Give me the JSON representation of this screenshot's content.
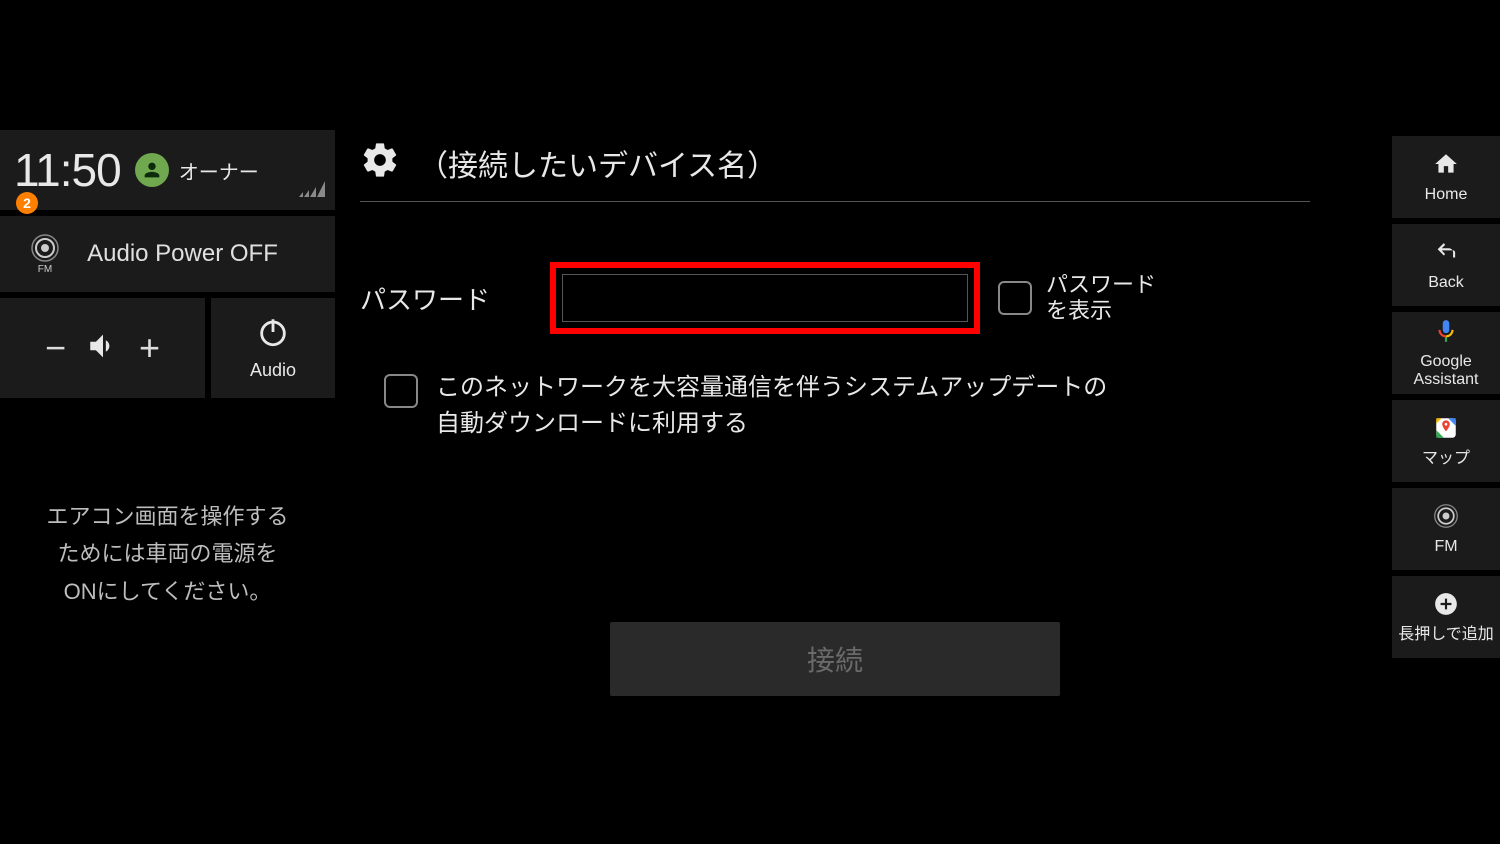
{
  "status": {
    "time": "11:50",
    "notification_count": "2",
    "user_name": "オーナー"
  },
  "audio": {
    "fm_sub": "FM",
    "power_label": "Audio Power OFF",
    "minus": "−",
    "plus": "+",
    "audio_button": "Audio"
  },
  "ac_message": {
    "line1": "エアコン画面を操作する",
    "line2": "ためには車両の電源を",
    "line3": "ONにしてください。"
  },
  "settings": {
    "title": "（接続したいデバイス名）",
    "password_label": "パスワード",
    "show_password_line1": "パスワード",
    "show_password_line2": "を表示",
    "auto_download_line1": "このネットワークを大容量通信を伴うシステムアップデートの",
    "auto_download_line2": "自動ダウンロードに利用する",
    "connect_button": "接続"
  },
  "nav": {
    "home": "Home",
    "back": "Back",
    "assistant_l1": "Google",
    "assistant_l2": "Assistant",
    "maps": "マップ",
    "fm": "FM",
    "add": "長押しで追加"
  }
}
